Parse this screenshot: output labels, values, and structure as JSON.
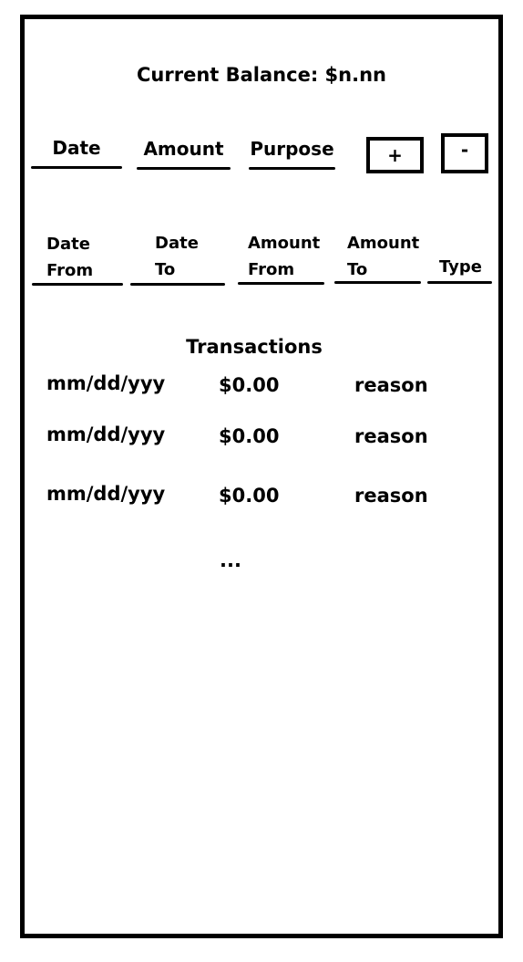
{
  "header": {
    "balance_text": "Current Balance: $n.nn"
  },
  "entry_form": {
    "date_label": "Date",
    "amount_label": "Amount",
    "purpose_label": "Purpose",
    "add_button": "+",
    "subtract_button": "-"
  },
  "filters": {
    "date_from": [
      "Date",
      "From"
    ],
    "date_to": [
      "Date",
      "To"
    ],
    "amount_from": [
      "Amount",
      "From"
    ],
    "amount_to": [
      "Amount",
      "To"
    ],
    "type": "Type"
  },
  "transactions": {
    "title": "Transactions",
    "rows": [
      {
        "date": "mm/dd/yyy",
        "amount": "$0.00",
        "reason": "reason"
      },
      {
        "date": "mm/dd/yyy",
        "amount": "$0.00",
        "reason": "reason"
      },
      {
        "date": "mm/dd/yyy",
        "amount": "$0.00",
        "reason": "reason"
      }
    ],
    "more_indicator": "..."
  }
}
